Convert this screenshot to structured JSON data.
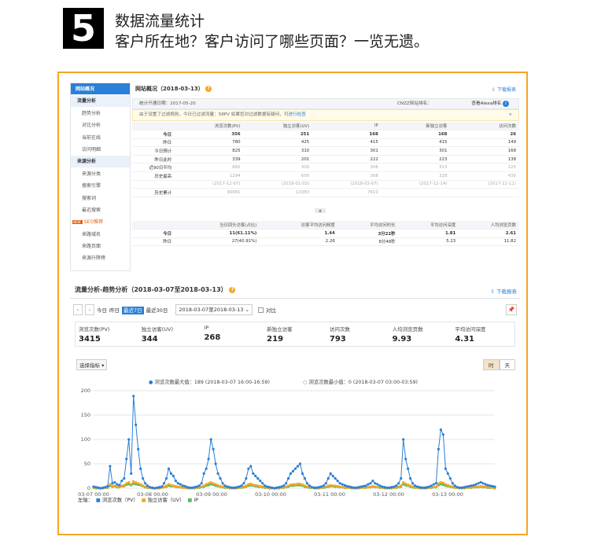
{
  "header": {
    "step": "5",
    "title": "数据流量统计",
    "subtitle": "客户所在地？客户访问了哪些页面？一览无遗。"
  },
  "sidebar": {
    "items": [
      {
        "label": "网站概况",
        "kind": "act"
      },
      {
        "label": "流量分析",
        "kind": "grp"
      },
      {
        "label": "趋势分析",
        "kind": "it"
      },
      {
        "label": "对比分析",
        "kind": "it"
      },
      {
        "label": "当前在线",
        "kind": "it"
      },
      {
        "label": "访问明细",
        "kind": "it"
      },
      {
        "label": "来源分析",
        "kind": "grp"
      },
      {
        "label": "来源分类",
        "kind": "it"
      },
      {
        "label": "搜索引擎",
        "kind": "it"
      },
      {
        "label": "搜索词",
        "kind": "it"
      },
      {
        "label": "最近搜索",
        "kind": "it"
      },
      {
        "label": "SEO推荐",
        "kind": "seo"
      },
      {
        "label": "来路域名",
        "kind": "it"
      },
      {
        "label": "来路页面",
        "kind": "it"
      },
      {
        "label": "来源升降榜",
        "kind": "it"
      }
    ]
  },
  "overview": {
    "title": "网站概况（2018-03-13）",
    "download": "下载报表",
    "start_date": "统计开通日期：2017-05-20",
    "cnzz_rank": "CNZZ网站排名：",
    "alexa": "查看Alexa排名",
    "notice": "由于设置了过滤规则，今日已过滤流量：58PV  如果您对过滤数据有疑问，可",
    "notice_link": "进行检查",
    "close": "×",
    "columns": [
      "",
      "浏览次数(PV)",
      "独立访客(UV)",
      "IP",
      "新独立访客",
      "访问次数"
    ],
    "rows": [
      {
        "label": "今日",
        "vals": [
          "356",
          "251",
          "168",
          "168",
          "26"
        ],
        "bold": true
      },
      {
        "label": "昨日",
        "vals": [
          "780",
          "425",
          "415",
          "415",
          "149"
        ]
      },
      {
        "label": "今日预计",
        "vals": [
          "825",
          "310",
          "301",
          "301",
          "168"
        ]
      },
      {
        "label": "昨日此时",
        "vals": [
          "339",
          "201",
          "222",
          "223",
          "138"
        ]
      },
      {
        "label": "近90日平均",
        "vals": [
          "682",
          "300",
          "306",
          "313",
          "125"
        ],
        "gray": true
      },
      {
        "label": "历史最高",
        "vals": [
          "1294",
          "600",
          "308",
          "328",
          "436"
        ],
        "gray": true
      },
      {
        "label": "",
        "vals": [
          "(2017-12-07)",
          "(2018-01-03)",
          "(2018-03-07)",
          "(2017-12-14)",
          "(2017-12-11)"
        ],
        "gray": true
      },
      {
        "label": "历史累计",
        "vals": [
          "90081",
          "10383",
          "7610",
          "",
          ""
        ],
        "gray": true
      }
    ],
    "columns2": [
      "",
      "当日回头访客(占比)",
      "访客平均访问频度",
      "平均访问时长",
      "平均访问深度",
      "人均浏览页数"
    ],
    "rows2": [
      {
        "label": "今日",
        "vals": [
          "11(61.11%)",
          "1.44",
          "3分22秒",
          "1.81",
          "2.61"
        ],
        "bold": true
      },
      {
        "label": "昨日",
        "vals": [
          "27(40.91%)",
          "2.26",
          "8分48秒",
          "5.23",
          "11.82"
        ]
      }
    ]
  },
  "trend": {
    "title": "流量分析-趋势分析（2018-03-07至2018-03-13）",
    "download": "下载报表",
    "quick": [
      "今日",
      "昨日",
      "最近7日",
      "最近30日"
    ],
    "selected": "最近7日",
    "range": "2018-03-07至2018-03-13",
    "compare": "对比",
    "stats": [
      {
        "k": "浏览次数(PV)",
        "v": "3415"
      },
      {
        "k": "独立访客(UV)",
        "v": "344"
      },
      {
        "k": "IP",
        "v": "268"
      },
      {
        "k": "新独立访客",
        "v": "219"
      },
      {
        "k": "访问次数",
        "v": "793"
      },
      {
        "k": "人均浏览页数",
        "v": "9.93"
      },
      {
        "k": "平均访问深度",
        "v": "4.31"
      }
    ],
    "metric_select": "选择指标",
    "hour": "时",
    "day": "天",
    "max_note": "浏览次数最大值：189 (2018-03-07 16:00-16:59)",
    "min_note": "浏览次数最小值：0 (2018-03-07 03:00-03:59)",
    "legend_prefix": "左轴：",
    "legend": [
      "浏览次数（PV）",
      "独立访客（UV）",
      "IP"
    ]
  },
  "chart_data": {
    "type": "line",
    "x": [
      "03-07 00:00",
      "03-08 00:00",
      "03-09 00:00",
      "03-10 00:00",
      "03-11 00:00",
      "03-12 00:00",
      "03-13 00:00"
    ],
    "ylim": [
      0,
      200
    ],
    "yticks": [
      0,
      50,
      100,
      150,
      200
    ],
    "series": [
      {
        "name": "浏览次数（PV）",
        "color": "#2a7fd6",
        "values": [
          3,
          2,
          1,
          0,
          1,
          2,
          4,
          45,
          10,
          12,
          8,
          6,
          15,
          20,
          60,
          100,
          30,
          189,
          130,
          80,
          40,
          20,
          10,
          5,
          2,
          1,
          0,
          1,
          2,
          3,
          10,
          20,
          40,
          30,
          25,
          15,
          10,
          8,
          5,
          4,
          2,
          1,
          1,
          2,
          3,
          5,
          10,
          30,
          40,
          60,
          100,
          80,
          50,
          30,
          20,
          10,
          5,
          3,
          2,
          1,
          1,
          2,
          3,
          5,
          10,
          20,
          40,
          45,
          30,
          25,
          20,
          15,
          10,
          5,
          3,
          2,
          1,
          0,
          1,
          2,
          3,
          5,
          10,
          20,
          30,
          35,
          40,
          45,
          50,
          30,
          20,
          10,
          5,
          2,
          1,
          1,
          2,
          3,
          5,
          10,
          20,
          30,
          25,
          20,
          15,
          10,
          8,
          6,
          4,
          3,
          2,
          1,
          1,
          2,
          3,
          4,
          5,
          8,
          10,
          15,
          10,
          8,
          5,
          3,
          2,
          1,
          1,
          2,
          3,
          5,
          10,
          20,
          100,
          60,
          40,
          20,
          10,
          5,
          3,
          2,
          1,
          1,
          2,
          3,
          5,
          8,
          10,
          80,
          120,
          110,
          40,
          30,
          20,
          10,
          5,
          2,
          1,
          1,
          2,
          3,
          4,
          5,
          6,
          8,
          10,
          12,
          10,
          8,
          6,
          5,
          4,
          3
        ]
      },
      {
        "name": "独立访客（UV）",
        "color": "#f5a623",
        "values": [
          1,
          1,
          0,
          0,
          0,
          1,
          2,
          8,
          4,
          5,
          3,
          2,
          5,
          6,
          10,
          12,
          8,
          14,
          12,
          10,
          8,
          5,
          3,
          2,
          1,
          0,
          0,
          0,
          1,
          1,
          3,
          5,
          8,
          6,
          5,
          4,
          3,
          2,
          1,
          1,
          1,
          0,
          0,
          1,
          1,
          2,
          3,
          5,
          8,
          10,
          12,
          10,
          8,
          6,
          4,
          3,
          2,
          1,
          1,
          0,
          0,
          1,
          1,
          2,
          3,
          5,
          8,
          9,
          7,
          6,
          5,
          4,
          3,
          2,
          1,
          1,
          0,
          0,
          0,
          1,
          1,
          2,
          3,
          5,
          7,
          8,
          8,
          9,
          9,
          7,
          5,
          3,
          2,
          1,
          0,
          0,
          1,
          1,
          2,
          3,
          5,
          6,
          5,
          5,
          4,
          3,
          2,
          2,
          1,
          1,
          1,
          0,
          0,
          1,
          1,
          1,
          2,
          2,
          3,
          4,
          3,
          2,
          2,
          1,
          1,
          0,
          0,
          1,
          1,
          2,
          3,
          5,
          12,
          9,
          7,
          5,
          3,
          2,
          1,
          1,
          0,
          0,
          1,
          1,
          2,
          2,
          3,
          10,
          12,
          11,
          8,
          6,
          4,
          3,
          2,
          1,
          0,
          0,
          1,
          1,
          1,
          2,
          2,
          3,
          3,
          4,
          3,
          3,
          2,
          2,
          1,
          1
        ]
      },
      {
        "name": "IP",
        "color": "#5cb85c",
        "values": [
          1,
          0,
          0,
          0,
          0,
          1,
          1,
          5,
          3,
          4,
          2,
          2,
          4,
          4,
          7,
          8,
          6,
          9,
          8,
          7,
          6,
          4,
          2,
          1,
          1,
          0,
          0,
          0,
          0,
          1,
          2,
          3,
          5,
          4,
          4,
          3,
          2,
          2,
          1,
          1,
          0,
          0,
          0,
          0,
          1,
          1,
          2,
          3,
          5,
          6,
          8,
          7,
          5,
          4,
          3,
          2,
          1,
          1,
          0,
          0,
          0,
          0,
          1,
          1,
          2,
          3,
          5,
          6,
          5,
          4,
          3,
          3,
          2,
          1,
          1,
          0,
          0,
          0,
          0,
          0,
          1,
          1,
          2,
          3,
          5,
          5,
          6,
          6,
          6,
          5,
          3,
          2,
          1,
          1,
          0,
          0,
          0,
          1,
          1,
          2,
          3,
          4,
          4,
          3,
          3,
          2,
          2,
          1,
          1,
          1,
          0,
          0,
          0,
          0,
          1,
          1,
          1,
          2,
          2,
          3,
          2,
          2,
          1,
          1,
          0,
          0,
          0,
          0,
          1,
          1,
          2,
          3,
          8,
          6,
          5,
          3,
          2,
          1,
          1,
          0,
          0,
          0,
          0,
          1,
          1,
          2,
          2,
          6,
          8,
          7,
          5,
          4,
          3,
          2,
          1,
          1,
          0,
          0,
          0,
          1,
          1,
          1,
          2,
          2,
          2,
          3,
          2,
          2,
          1,
          1,
          1,
          0
        ]
      }
    ]
  }
}
